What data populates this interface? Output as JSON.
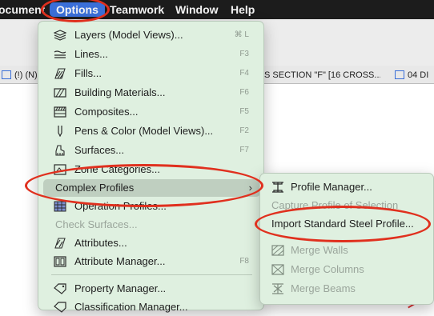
{
  "menubar": {
    "items": [
      "ocument",
      "Options",
      "Teamwork",
      "Window",
      "Help"
    ]
  },
  "tabs": {
    "left": "(!) (N)",
    "middle": "S SECTION \"F\" [16 CROSS...",
    "right": "04 DI"
  },
  "options_menu": {
    "items": [
      {
        "label": "Layers (Model Views)...",
        "shortcut": "⌘ L",
        "icon": "layers-icon"
      },
      {
        "label": "Lines...",
        "shortcut": "F3",
        "icon": "lines-icon"
      },
      {
        "label": "Fills...",
        "shortcut": "F4",
        "icon": "fills-icon"
      },
      {
        "label": "Building Materials...",
        "shortcut": "F6",
        "icon": "building-materials-icon"
      },
      {
        "label": "Composites...",
        "shortcut": "F5",
        "icon": "composites-icon"
      },
      {
        "label": "Pens & Color (Model Views)...",
        "shortcut": "F2",
        "icon": "pen-icon"
      },
      {
        "label": "Surfaces...",
        "shortcut": "F7",
        "icon": "surfaces-icon"
      },
      {
        "label": "Zone Categories...",
        "shortcut": "",
        "icon": "zone-icon"
      },
      {
        "label": "Complex Profiles",
        "shortcut": "",
        "icon": ""
      },
      {
        "label": "Operation Profiles...",
        "shortcut": "",
        "icon": "operation-profiles-icon"
      },
      {
        "label": "Check Surfaces...",
        "shortcut": "",
        "icon": ""
      },
      {
        "label": "Attributes...",
        "shortcut": "",
        "icon": "attributes-icon"
      },
      {
        "label": "Attribute Manager...",
        "shortcut": "F8",
        "icon": "attribute-manager-icon"
      },
      {
        "label": "Property Manager...",
        "shortcut": "",
        "icon": "property-manager-icon"
      },
      {
        "label": "Classification Manager...",
        "shortcut": "",
        "icon": "classification-icon"
      }
    ],
    "submenu_chevron": "›"
  },
  "complex_profiles_submenu": {
    "items": [
      {
        "label": "Profile Manager...",
        "icon": "profile-manager-icon"
      },
      {
        "label": "Capture Profile of Selection",
        "icon": ""
      },
      {
        "label": "Import Standard Steel Profile...",
        "icon": ""
      },
      {
        "label": "Merge Walls",
        "icon": "merge-walls-icon"
      },
      {
        "label": "Merge Columns",
        "icon": "merge-columns-icon"
      },
      {
        "label": "Merge Beams",
        "icon": "merge-beams-icon"
      }
    ]
  },
  "colors": {
    "menu_bg": "#dff0e0",
    "highlight": "#bfcfc0",
    "annotation": "#e0301e",
    "menubar_active": "#3a6fd8"
  }
}
